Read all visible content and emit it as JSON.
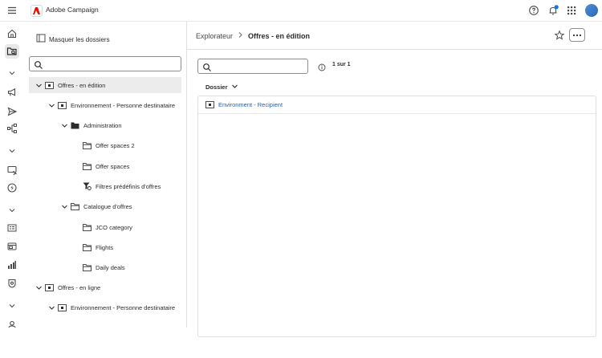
{
  "app": {
    "title": "Adobe Campaign"
  },
  "topbar": {
    "icons": [
      "help-icon",
      "notification-bell-icon",
      "apps-grid-icon",
      "avatar"
    ],
    "accent": "#1473e6"
  },
  "rail": {
    "items": [
      "home-icon",
      "explorer-icon",
      "chevron-down-icon",
      "campaign-megaphone-icon",
      "send-icon",
      "workflow-icon",
      "chevron-down-icon",
      "content-icon",
      "offer-icon",
      "chevron-down-icon",
      "audience-list-icon",
      "templates-icon",
      "reports-icon",
      "security-icon",
      "chevron-down-icon",
      "user-icon",
      "administration-icon"
    ]
  },
  "explorer": {
    "hide_folders_label": "Masquer les dossiers",
    "search_placeholder": "",
    "tree": [
      {
        "label": "Offres - en édition"
      },
      {
        "label": "Environnement - Personne destinataire"
      },
      {
        "label": "Administration"
      },
      {
        "label": "Offer spaces 2"
      },
      {
        "label": "Offer spaces"
      },
      {
        "label": "Filtres prédéfinis d'offres"
      },
      {
        "label": "Catalogue d'offres"
      },
      {
        "label": "JCO category"
      },
      {
        "label": "Flights"
      },
      {
        "label": "Daily deals"
      },
      {
        "label": "Offres - en ligne"
      },
      {
        "label": "Environnement - Personne destinataire"
      }
    ]
  },
  "content": {
    "breadcrumb_root": "Explorateur",
    "breadcrumb_current": "Offres - en édition",
    "search_placeholder": "",
    "pager": "1 sur 1",
    "column_header": "Dossier",
    "rows": [
      {
        "label": "Environment - Recipient"
      }
    ]
  }
}
